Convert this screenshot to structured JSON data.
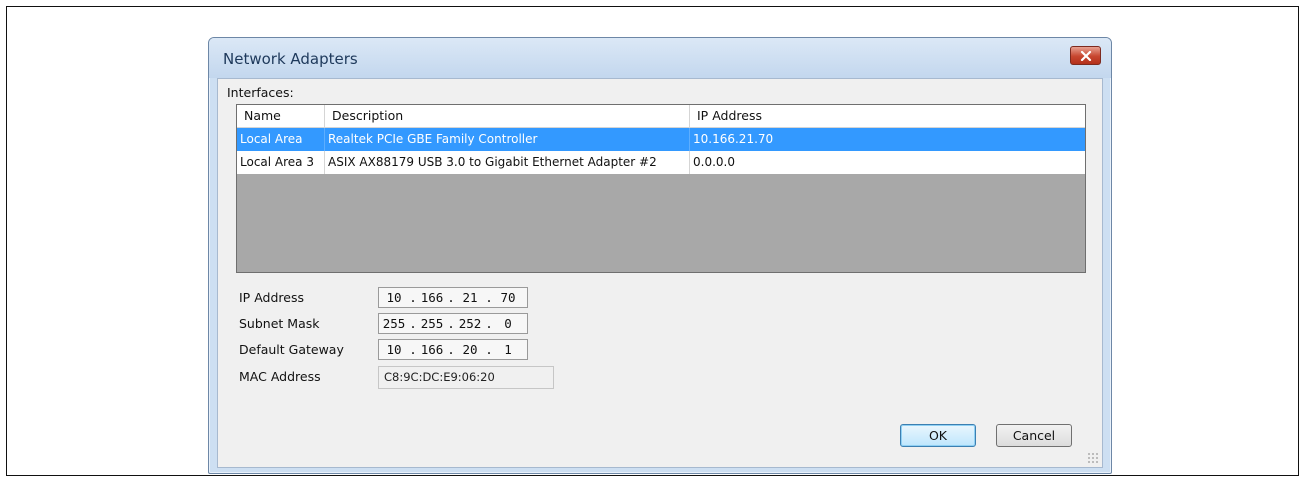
{
  "window": {
    "title": "Network Adapters"
  },
  "interfaces": {
    "label": "Interfaces:",
    "columns": [
      "Name",
      "Description",
      "IP Address"
    ],
    "rows": [
      {
        "name": "Local Area",
        "description": "Realtek PCIe GBE Family Controller",
        "ip": "10.166.21.70",
        "selected": true
      },
      {
        "name": "Local Area 3",
        "description": "ASIX AX88179 USB 3.0 to Gigabit Ethernet Adapter #2",
        "ip": "0.0.0.0",
        "selected": false
      }
    ]
  },
  "details": {
    "ip_label": "IP Address",
    "ip": [
      "10",
      "166",
      "21",
      "70"
    ],
    "subnet_label": "Subnet Mask",
    "subnet": [
      "255",
      "255",
      "252",
      "0"
    ],
    "gateway_label": "Default Gateway",
    "gateway": [
      "10",
      "166",
      "20",
      "1"
    ],
    "mac_label": "MAC Address",
    "mac": "C8:9C:DC:E9:06:20"
  },
  "buttons": {
    "ok": "OK",
    "cancel": "Cancel"
  },
  "icons": {
    "close": "close-icon",
    "resize": "resize-grip-icon"
  },
  "colors": {
    "selection": "#3399ff",
    "close_button": "#c7462f"
  }
}
